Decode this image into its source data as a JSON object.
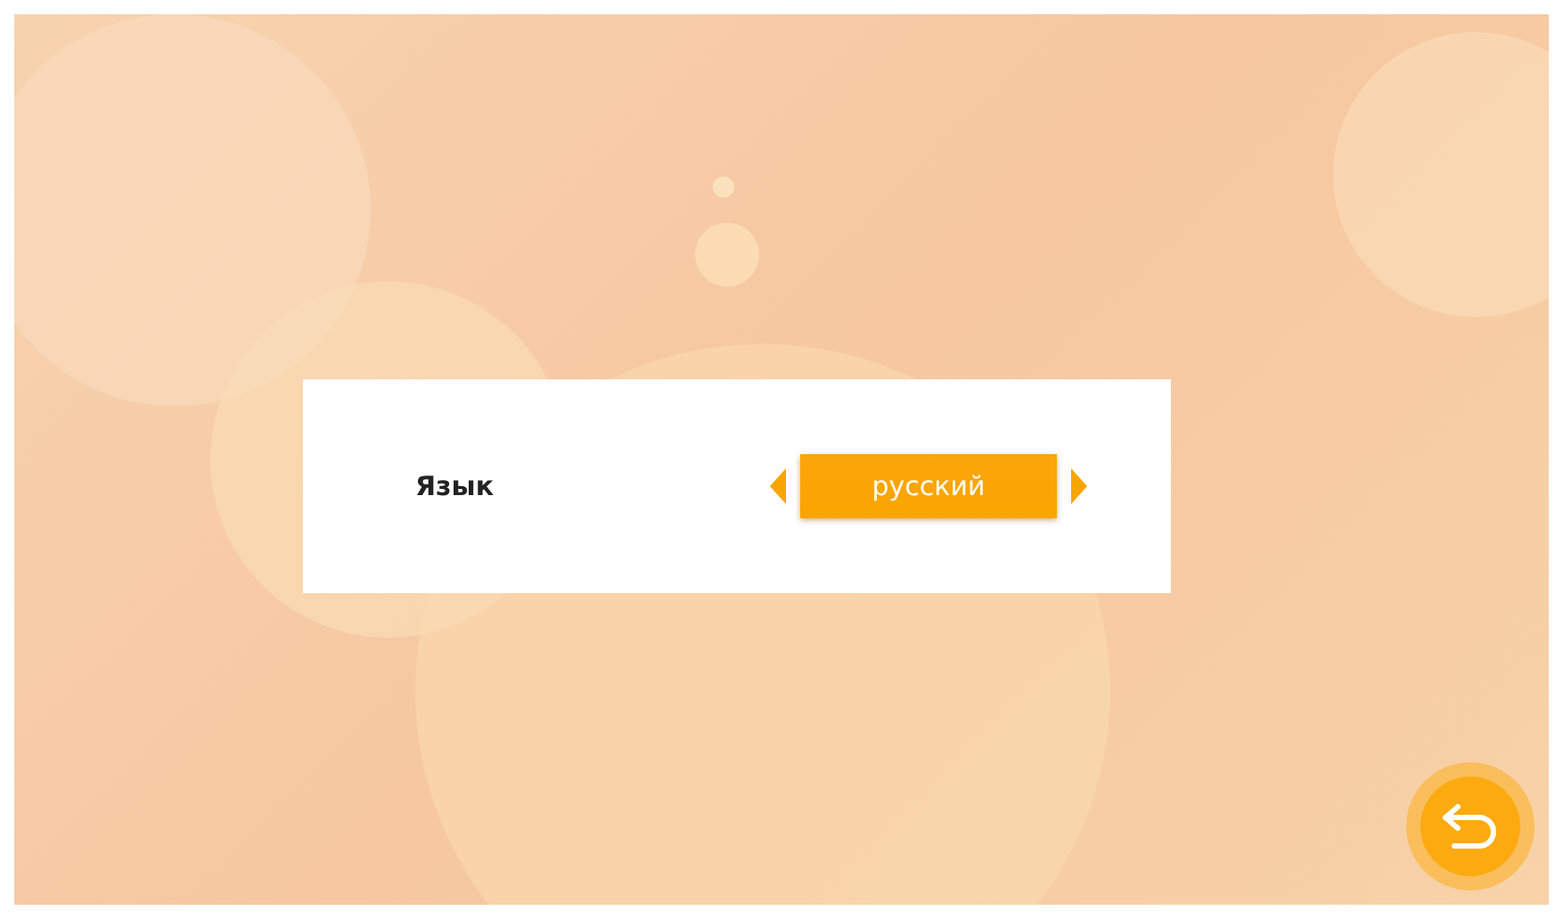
{
  "setting": {
    "label": "Язык",
    "value": "русский"
  }
}
